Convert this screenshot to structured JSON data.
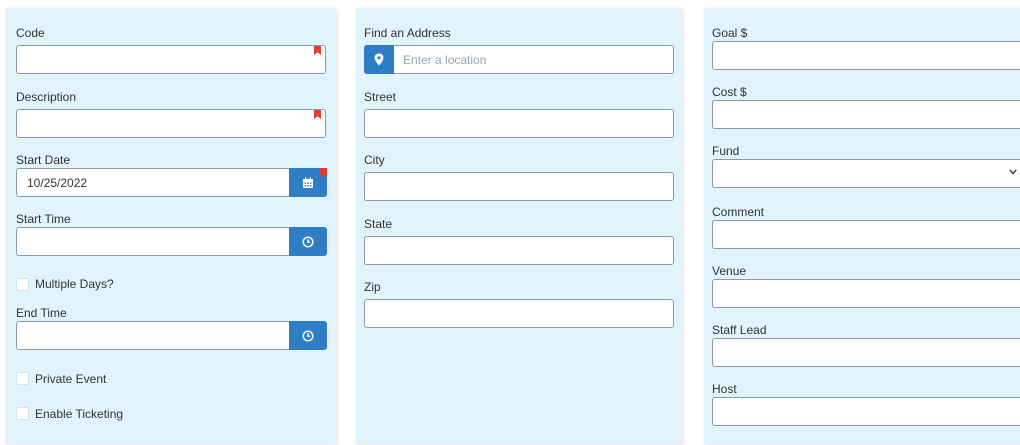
{
  "left_panel": {
    "code_label": "Code",
    "code_value": "",
    "description_label": "Description",
    "description_value": "",
    "start_date_label": "Start Date",
    "start_date_value": "10/25/2022",
    "start_time_label": "Start Time",
    "start_time_value": "",
    "multiple_days_label": "Multiple Days?",
    "end_time_label": "End Time",
    "end_time_value": "",
    "private_event_label": "Private Event",
    "enable_ticketing_label": "Enable Ticketing"
  },
  "middle_panel": {
    "find_address_label": "Find an Address",
    "location_placeholder": "Enter a location",
    "street_label": "Street",
    "city_label": "City",
    "state_label": "State",
    "zip_label": "Zip"
  },
  "right_panel": {
    "goal_label": "Goal $",
    "cost_label": "Cost $",
    "fund_label": "Fund",
    "fund_selected": "",
    "comment_label": "Comment",
    "venue_label": "Venue",
    "staff_lead_label": "Staff Lead",
    "host_label": "Host"
  },
  "colors": {
    "panel_bg": "#e1f3fc",
    "accent": "#2f7dc4",
    "required_flag": "#e03b2f"
  },
  "icons": {
    "date_picker": "calendar-icon",
    "time_picker": "clock-icon",
    "location": "map-pin-icon",
    "select": "chevron-down-icon",
    "required": "bookmark-flag-icon"
  }
}
